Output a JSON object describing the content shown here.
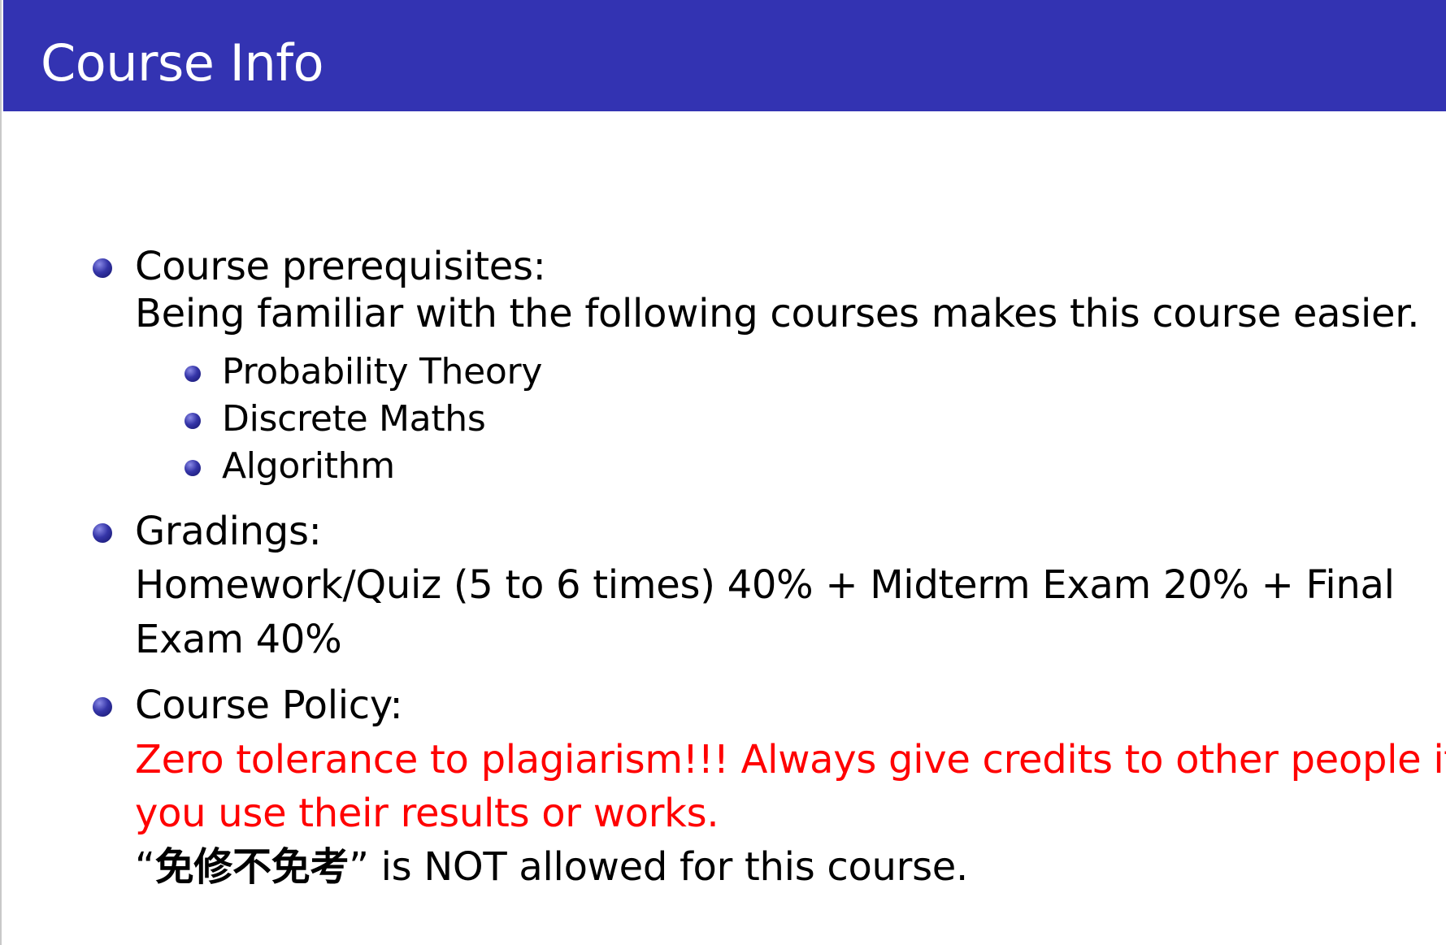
{
  "slide": {
    "title": "Course Info",
    "colors": {
      "title_bar": "#3333b2",
      "title_text": "#ffffff",
      "bullet": "#3535a8",
      "emphasis": "#ff0000"
    },
    "items": [
      {
        "label": "Course prerequisites:",
        "text": "Being familiar with the following courses makes this course easier.",
        "subitems": [
          "Probability Theory",
          "Discrete Maths",
          "Algorithm"
        ]
      },
      {
        "label": "Gradings:",
        "text_line1": "Homework/Quiz (5 to 6 times) 40% + Midterm Exam 20% + Final",
        "text_line2": "Exam 40%"
      },
      {
        "label": "Course Policy:",
        "warning_line1": "Zero tolerance to plagiarism!!! Always give credits to other people if",
        "warning_line2": "you use their results or works.",
        "note_open_quote": "“",
        "note_term": "免修不免考",
        "note_rest": "” is NOT allowed for this course."
      }
    ]
  }
}
